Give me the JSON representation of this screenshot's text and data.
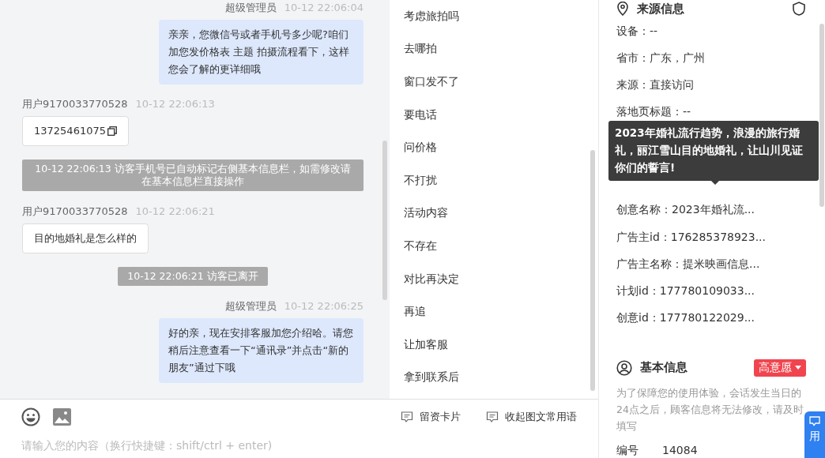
{
  "chat": {
    "messages": [
      {
        "kind": "agent",
        "sender": "超级管理员",
        "time": "10-12 22:06:04",
        "text": "亲亲，您微信号或者手机号多少呢?咱们加您发价格表 主题 拍摄流程看下，这样您会了解的更详细哦"
      },
      {
        "kind": "visitor",
        "sender": "用户9170033770528",
        "time": "10-12 22:06:13",
        "text": "13725461075",
        "copyable": true
      },
      {
        "kind": "system",
        "text": "10-12 22:06:13 访客手机号已自动标记右侧基本信息栏，如需修改请在基本信息栏直接操作"
      },
      {
        "kind": "visitor",
        "sender": "用户9170033770528",
        "time": "10-12 22:06:21",
        "text": "目的地婚礼是怎么样的",
        "copyable": false
      },
      {
        "kind": "system",
        "text": "10-12 22:06:21 访客已离开"
      },
      {
        "kind": "agent",
        "sender": "超级管理员",
        "time": "10-12 22:06:25",
        "text": "好的亲，现在安排客服加您介绍哈。请您稍后注意查看一下“通讯录”并点击“新的朋友”通过下哦"
      }
    ]
  },
  "phrases": [
    "考虑旅拍吗",
    "去哪拍",
    "窗口发不了",
    "要电话",
    "问价格",
    "不打扰",
    "活动内容",
    "不存在",
    "对比再决定",
    "再追",
    "让加客服",
    "拿到联系后"
  ],
  "composer": {
    "placeholder": "请输入您的内容（换行快捷键：shift/ctrl + enter)",
    "tools": [
      {
        "label": "留资卡片"
      },
      {
        "label": "收起图文常用语"
      }
    ]
  },
  "source_info": {
    "title": "来源信息",
    "items": [
      {
        "kind": "field",
        "text": "设备：--"
      },
      {
        "kind": "field",
        "text": "省市：广东，广州"
      },
      {
        "kind": "field",
        "text": "来源：直接访问"
      },
      {
        "kind": "field",
        "text": "落地页标题：--"
      },
      {
        "kind": "tooltip",
        "text": "2023年婚礼流行趋势，浪漫的旅行婚礼，丽江雪山目的地婚礼，让山川见证你们的誓言!"
      },
      {
        "kind": "field",
        "text": "创意名称：2023年婚礼流..."
      },
      {
        "kind": "field",
        "text": "广告主id：176285378923..."
      },
      {
        "kind": "field",
        "text": "广告主名称：提米映画信息..."
      },
      {
        "kind": "field",
        "text": "计划id：177780109033..."
      },
      {
        "kind": "field",
        "text": "创意id：177780122029..."
      }
    ]
  },
  "basic_info": {
    "title": "基本信息",
    "intent_tag": "高意愿",
    "note": "为了保障您的使用体验，会话发生当日的24点之后，顾客信息将无法修改，请及时填写",
    "fields": [
      {
        "label": "编号",
        "value": "14084"
      }
    ]
  },
  "float_button": "用"
}
